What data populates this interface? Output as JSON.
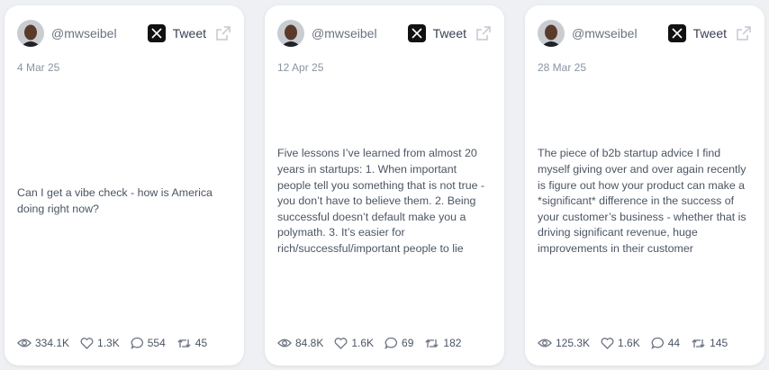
{
  "cards": [
    {
      "handle": "@mwseibel",
      "tweet_label": "Tweet",
      "date": "4 Mar 25",
      "text": "Can I get a vibe check - how is America doing right now?",
      "stats": {
        "views": "334.1K",
        "likes": "1.3K",
        "replies": "554",
        "retweets": "45"
      }
    },
    {
      "handle": "@mwseibel",
      "tweet_label": "Tweet",
      "date": "12 Apr 25",
      "text": "Five lessons I’ve learned from almost 20 years in startups: 1. When important people tell you something that is not true - you don’t have to believe them. 2. Being successful doesn’t default make you a polymath. 3. It’s easier for rich/successful/important people to lie",
      "stats": {
        "views": "84.8K",
        "likes": "1.6K",
        "replies": "69",
        "retweets": "182"
      }
    },
    {
      "handle": "@mwseibel",
      "tweet_label": "Tweet",
      "date": "28 Mar 25",
      "text": "The piece of b2b startup advice I find myself giving over and over again recently is figure out how your product can make a *significant* difference in the success of your customer’s business - whether that is driving significant revenue, huge improvements in their customer",
      "stats": {
        "views": "125.3K",
        "likes": "1.6K",
        "replies": "44",
        "retweets": "145"
      }
    }
  ],
  "icons": {
    "avatar": "profile-photo",
    "x_logo": "x-logo-icon",
    "external": "external-link-icon",
    "views": "eye-icon",
    "likes": "heart-icon",
    "replies": "comment-icon",
    "retweets": "retweet-icon"
  },
  "colors": {
    "background": "#eef0f3",
    "card": "#ffffff",
    "muted": "#8a94a2",
    "text": "#4b5563"
  }
}
